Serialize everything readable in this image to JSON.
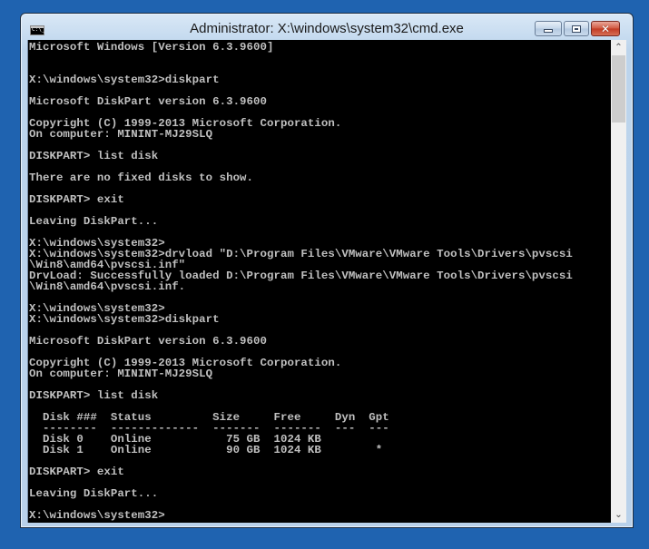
{
  "window": {
    "title": "Administrator: X:\\windows\\system32\\cmd.exe",
    "icon": "cmd-icon",
    "icon_text": "C:\\_",
    "buttons": {
      "minimize": "minimize-icon",
      "maximize": "maximize-icon",
      "close_glyph": "✕"
    }
  },
  "console": {
    "lines": [
      {
        "row": 0,
        "text": "Microsoft Windows [Version 6.3.9600]"
      },
      {
        "row": 3,
        "text": "X:\\windows\\system32>diskpart"
      },
      {
        "row": 5,
        "text": "Microsoft DiskPart version 6.3.9600"
      },
      {
        "row": 7,
        "text": "Copyright (C) 1999-2013 Microsoft Corporation."
      },
      {
        "row": 8,
        "text": "On computer: MININT-MJ29SLQ"
      },
      {
        "row": 10,
        "text": "DISKPART> list disk"
      },
      {
        "row": 12,
        "text": "There are no fixed disks to show."
      },
      {
        "row": 14,
        "text": "DISKPART> exit"
      },
      {
        "row": 16,
        "text": "Leaving DiskPart..."
      },
      {
        "row": 18,
        "text": "X:\\windows\\system32>"
      },
      {
        "row": 19,
        "text": "X:\\windows\\system32>drvload \"D:\\Program Files\\VMware\\VMware Tools\\Drivers\\pvscsi"
      },
      {
        "row": 20,
        "text": "\\Win8\\amd64\\pvscsi.inf\""
      },
      {
        "row": 21,
        "text": "DrvLoad: Successfully loaded D:\\Program Files\\VMware\\VMware Tools\\Drivers\\pvscsi"
      },
      {
        "row": 22,
        "text": "\\Win8\\amd64\\pvscsi.inf."
      },
      {
        "row": 24,
        "text": "X:\\windows\\system32>"
      },
      {
        "row": 25,
        "text": "X:\\windows\\system32>diskpart"
      },
      {
        "row": 27,
        "text": "Microsoft DiskPart version 6.3.9600"
      },
      {
        "row": 29,
        "text": "Copyright (C) 1999-2013 Microsoft Corporation."
      },
      {
        "row": 30,
        "text": "On computer: MININT-MJ29SLQ"
      },
      {
        "row": 32,
        "text": "DISKPART> list disk"
      },
      {
        "row": 34,
        "text": "  Disk ###  Status         Size     Free     Dyn  Gpt"
      },
      {
        "row": 35,
        "text": "  --------  -------------  -------  -------  ---  ---"
      },
      {
        "row": 36,
        "text": "  Disk 0    Online           75 GB  1024 KB"
      },
      {
        "row": 37,
        "text": "  Disk 1    Online           90 GB  1024 KB        *"
      },
      {
        "row": 39,
        "text": "DISKPART> exit"
      },
      {
        "row": 41,
        "text": "Leaving DiskPart..."
      },
      {
        "row": 43,
        "text": "X:\\windows\\system32>"
      }
    ],
    "disk_table": {
      "columns": [
        "Disk ###",
        "Status",
        "Size",
        "Free",
        "Dyn",
        "Gpt"
      ],
      "rows": [
        [
          "Disk 0",
          "Online",
          "75 GB",
          "1024 KB",
          "",
          ""
        ],
        [
          "Disk 1",
          "Online",
          "90 GB",
          "1024 KB",
          "",
          "*"
        ]
      ]
    },
    "text_color": "#c0c0c0",
    "background_color": "#000000"
  },
  "scrollbar": {
    "up_arrow": "⌃",
    "down_arrow": "⌄",
    "position_fraction": 0.0
  }
}
